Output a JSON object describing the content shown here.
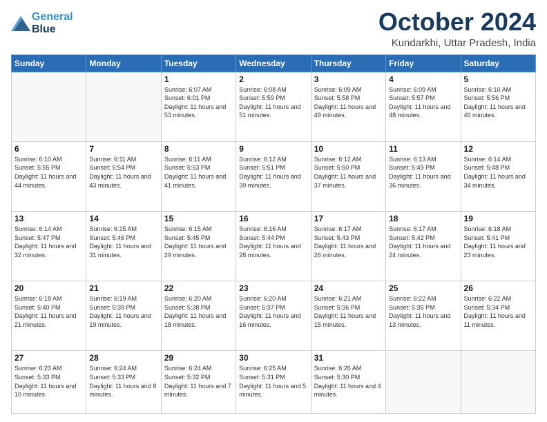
{
  "header": {
    "logo_line1": "General",
    "logo_line2": "Blue",
    "month": "October 2024",
    "location": "Kundarkhi, Uttar Pradesh, India"
  },
  "weekdays": [
    "Sunday",
    "Monday",
    "Tuesday",
    "Wednesday",
    "Thursday",
    "Friday",
    "Saturday"
  ],
  "weeks": [
    [
      {
        "day": "",
        "sunrise": "",
        "sunset": "",
        "daylight": ""
      },
      {
        "day": "",
        "sunrise": "",
        "sunset": "",
        "daylight": ""
      },
      {
        "day": "1",
        "sunrise": "Sunrise: 6:07 AM",
        "sunset": "Sunset: 6:01 PM",
        "daylight": "Daylight: 11 hours and 53 minutes."
      },
      {
        "day": "2",
        "sunrise": "Sunrise: 6:08 AM",
        "sunset": "Sunset: 5:59 PM",
        "daylight": "Daylight: 11 hours and 51 minutes."
      },
      {
        "day": "3",
        "sunrise": "Sunrise: 6:09 AM",
        "sunset": "Sunset: 5:58 PM",
        "daylight": "Daylight: 11 hours and 49 minutes."
      },
      {
        "day": "4",
        "sunrise": "Sunrise: 6:09 AM",
        "sunset": "Sunset: 5:57 PM",
        "daylight": "Daylight: 11 hours and 48 minutes."
      },
      {
        "day": "5",
        "sunrise": "Sunrise: 6:10 AM",
        "sunset": "Sunset: 5:56 PM",
        "daylight": "Daylight: 11 hours and 46 minutes."
      }
    ],
    [
      {
        "day": "6",
        "sunrise": "Sunrise: 6:10 AM",
        "sunset": "Sunset: 5:55 PM",
        "daylight": "Daylight: 11 hours and 44 minutes."
      },
      {
        "day": "7",
        "sunrise": "Sunrise: 6:11 AM",
        "sunset": "Sunset: 5:54 PM",
        "daylight": "Daylight: 11 hours and 43 minutes."
      },
      {
        "day": "8",
        "sunrise": "Sunrise: 6:11 AM",
        "sunset": "Sunset: 5:53 PM",
        "daylight": "Daylight: 11 hours and 41 minutes."
      },
      {
        "day": "9",
        "sunrise": "Sunrise: 6:12 AM",
        "sunset": "Sunset: 5:51 PM",
        "daylight": "Daylight: 11 hours and 39 minutes."
      },
      {
        "day": "10",
        "sunrise": "Sunrise: 6:12 AM",
        "sunset": "Sunset: 5:50 PM",
        "daylight": "Daylight: 11 hours and 37 minutes."
      },
      {
        "day": "11",
        "sunrise": "Sunrise: 6:13 AM",
        "sunset": "Sunset: 5:49 PM",
        "daylight": "Daylight: 11 hours and 36 minutes."
      },
      {
        "day": "12",
        "sunrise": "Sunrise: 6:14 AM",
        "sunset": "Sunset: 5:48 PM",
        "daylight": "Daylight: 11 hours and 34 minutes."
      }
    ],
    [
      {
        "day": "13",
        "sunrise": "Sunrise: 6:14 AM",
        "sunset": "Sunset: 5:47 PM",
        "daylight": "Daylight: 11 hours and 32 minutes."
      },
      {
        "day": "14",
        "sunrise": "Sunrise: 6:15 AM",
        "sunset": "Sunset: 5:46 PM",
        "daylight": "Daylight: 11 hours and 31 minutes."
      },
      {
        "day": "15",
        "sunrise": "Sunrise: 6:15 AM",
        "sunset": "Sunset: 5:45 PM",
        "daylight": "Daylight: 11 hours and 29 minutes."
      },
      {
        "day": "16",
        "sunrise": "Sunrise: 6:16 AM",
        "sunset": "Sunset: 5:44 PM",
        "daylight": "Daylight: 11 hours and 28 minutes."
      },
      {
        "day": "17",
        "sunrise": "Sunrise: 6:17 AM",
        "sunset": "Sunset: 5:43 PM",
        "daylight": "Daylight: 11 hours and 26 minutes."
      },
      {
        "day": "18",
        "sunrise": "Sunrise: 6:17 AM",
        "sunset": "Sunset: 5:42 PM",
        "daylight": "Daylight: 11 hours and 24 minutes."
      },
      {
        "day": "19",
        "sunrise": "Sunrise: 6:18 AM",
        "sunset": "Sunset: 5:41 PM",
        "daylight": "Daylight: 11 hours and 23 minutes."
      }
    ],
    [
      {
        "day": "20",
        "sunrise": "Sunrise: 6:18 AM",
        "sunset": "Sunset: 5:40 PM",
        "daylight": "Daylight: 11 hours and 21 minutes."
      },
      {
        "day": "21",
        "sunrise": "Sunrise: 6:19 AM",
        "sunset": "Sunset: 5:39 PM",
        "daylight": "Daylight: 11 hours and 19 minutes."
      },
      {
        "day": "22",
        "sunrise": "Sunrise: 6:20 AM",
        "sunset": "Sunset: 5:38 PM",
        "daylight": "Daylight: 11 hours and 18 minutes."
      },
      {
        "day": "23",
        "sunrise": "Sunrise: 6:20 AM",
        "sunset": "Sunset: 5:37 PM",
        "daylight": "Daylight: 11 hours and 16 minutes."
      },
      {
        "day": "24",
        "sunrise": "Sunrise: 6:21 AM",
        "sunset": "Sunset: 5:36 PM",
        "daylight": "Daylight: 11 hours and 15 minutes."
      },
      {
        "day": "25",
        "sunrise": "Sunrise: 6:22 AM",
        "sunset": "Sunset: 5:35 PM",
        "daylight": "Daylight: 11 hours and 13 minutes."
      },
      {
        "day": "26",
        "sunrise": "Sunrise: 6:22 AM",
        "sunset": "Sunset: 5:34 PM",
        "daylight": "Daylight: 11 hours and 11 minutes."
      }
    ],
    [
      {
        "day": "27",
        "sunrise": "Sunrise: 6:23 AM",
        "sunset": "Sunset: 5:33 PM",
        "daylight": "Daylight: 11 hours and 10 minutes."
      },
      {
        "day": "28",
        "sunrise": "Sunrise: 6:24 AM",
        "sunset": "Sunset: 5:33 PM",
        "daylight": "Daylight: 11 hours and 8 minutes."
      },
      {
        "day": "29",
        "sunrise": "Sunrise: 6:24 AM",
        "sunset": "Sunset: 5:32 PM",
        "daylight": "Daylight: 11 hours and 7 minutes."
      },
      {
        "day": "30",
        "sunrise": "Sunrise: 6:25 AM",
        "sunset": "Sunset: 5:31 PM",
        "daylight": "Daylight: 11 hours and 5 minutes."
      },
      {
        "day": "31",
        "sunrise": "Sunrise: 6:26 AM",
        "sunset": "Sunset: 5:30 PM",
        "daylight": "Daylight: 11 hours and 4 minutes."
      },
      {
        "day": "",
        "sunrise": "",
        "sunset": "",
        "daylight": ""
      },
      {
        "day": "",
        "sunrise": "",
        "sunset": "",
        "daylight": ""
      }
    ]
  ]
}
